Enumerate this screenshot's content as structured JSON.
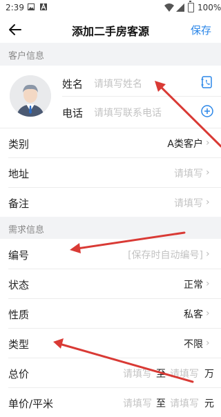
{
  "status_bar": {
    "time": "2:39",
    "battery": "100%",
    "icons": [
      "image-icon",
      "a-icon",
      "wifi-icon",
      "signal-icon",
      "battery-icon"
    ]
  },
  "app_bar": {
    "title": "添加二手房客源",
    "save_label": "保存"
  },
  "sections": {
    "customer": "客户信息",
    "demand": "需求信息"
  },
  "profile": {
    "name_label": "姓名",
    "name_placeholder": "请填写姓名",
    "phone_label": "电话",
    "phone_placeholder": "请填写联系电话"
  },
  "customer_rows": [
    {
      "label": "类别",
      "value": "A类客户"
    },
    {
      "label": "地址",
      "value": "请填写"
    },
    {
      "label": "备注",
      "value": "请填写"
    }
  ],
  "demand_rows": [
    {
      "label": "编号",
      "value": "[保存时自动编号]"
    },
    {
      "label": "状态",
      "value": "正常"
    },
    {
      "label": "性质",
      "value": "私客"
    },
    {
      "label": "类型",
      "value": "不限"
    }
  ],
  "range_rows": [
    {
      "label": "总价",
      "from": "请填写",
      "to_word": "至",
      "to": "请填写",
      "unit": "万"
    },
    {
      "label": "单价/平米",
      "from": "请填写",
      "to_word": "至",
      "to": "请填写",
      "unit": "元"
    }
  ],
  "colors": {
    "accent": "#2a86e8",
    "annotation_arrow": "#d93a35",
    "section_bg": "#f2f3f5"
  }
}
